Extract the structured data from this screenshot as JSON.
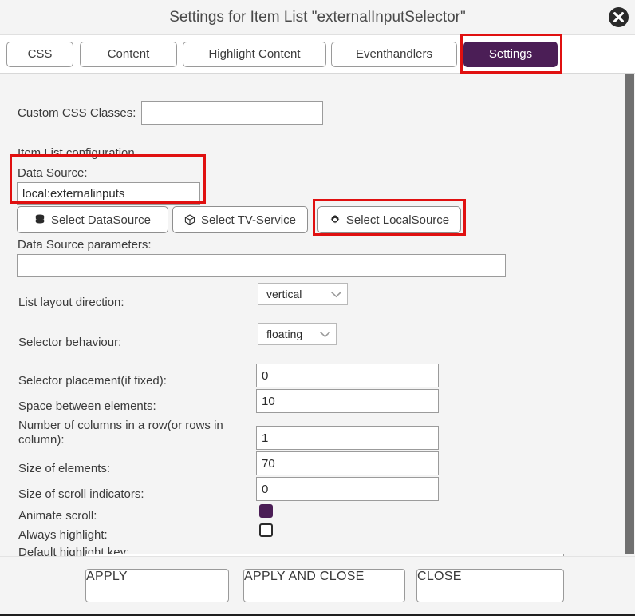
{
  "window": {
    "title": "Settings for Item List \"externalInputSelector\"",
    "close_icon": "close-circle-icon"
  },
  "tabs": [
    {
      "label": "CSS",
      "active": false
    },
    {
      "label": "Content",
      "active": false
    },
    {
      "label": "Highlight Content",
      "active": false
    },
    {
      "label": "Eventhandlers",
      "active": false
    },
    {
      "label": "Settings",
      "active": true
    }
  ],
  "form": {
    "custom_css_label": "Custom CSS Classes:",
    "custom_css_value": "",
    "section_title": "Item List configuration",
    "data_source_label": "Data Source:",
    "data_source_value": "local:externalinputs",
    "source_buttons": [
      {
        "label": "Select DataSource",
        "icon": "database-icon"
      },
      {
        "label": "Select TV-Service",
        "icon": "cube-icon"
      },
      {
        "label": "Select LocalSource",
        "icon": "gear-icon"
      }
    ],
    "data_source_params_label": "Data Source parameters:",
    "data_source_params_value": "",
    "list_layout_label": "List layout direction:",
    "list_layout_value": "vertical",
    "selector_behaviour_label": "Selector behaviour:",
    "selector_behaviour_value": "floating",
    "selector_placement_label": "Selector placement(if fixed):",
    "selector_placement_value": "0",
    "space_between_label": "Space between elements:",
    "space_between_value": "10",
    "columns_label": "Number of columns in a row(or rows in column):",
    "columns_value": "1",
    "size_elements_label": "Size of elements:",
    "size_elements_value": "70",
    "size_scroll_label": "Size of scroll indicators:",
    "size_scroll_value": "0",
    "animate_scroll_label": "Animate scroll:",
    "animate_scroll_checked": true,
    "always_highlight_label": "Always highlight:",
    "always_highlight_checked": false,
    "default_highlight_label": "Default highlight key:",
    "default_highlight_value": ""
  },
  "footer": {
    "apply_label": "APPLY",
    "apply_close_label": "APPLY AND CLOSE",
    "close_label": "CLOSE"
  },
  "colors": {
    "accent": "#4b1e56",
    "annotation": "#e01010",
    "panel_bg": "#f4f4f4",
    "scrollbar": "#707070"
  }
}
